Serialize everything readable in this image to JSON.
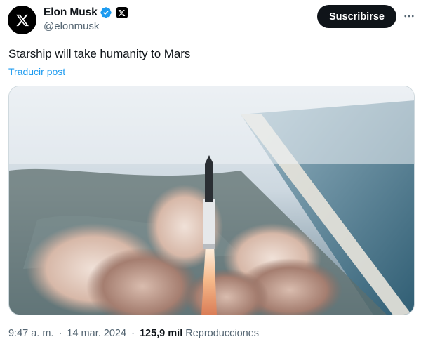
{
  "author": {
    "name": "Elon Musk",
    "handle": "@elonmusk",
    "avatar_icon": "x-logo-icon",
    "verified_icon": "verified-badge-icon",
    "affiliation_icon": "x-affiliate-badge-icon"
  },
  "actions": {
    "subscribe_label": "Suscribirse",
    "more_icon": "more-options-icon"
  },
  "post": {
    "text": "Starship will take humanity to Mars",
    "translate_label": "Traducir post",
    "media_alt": "Starship launch photo"
  },
  "meta": {
    "time": "9:47 a. m.",
    "separator": "·",
    "date": "14 mar. 2024",
    "views_count": "125,9 mil",
    "views_label": "Reproducciones"
  },
  "colors": {
    "text": "#0f1419",
    "secondary": "#536471",
    "link": "#1d9bf0",
    "verified": "#1d9bf0"
  }
}
